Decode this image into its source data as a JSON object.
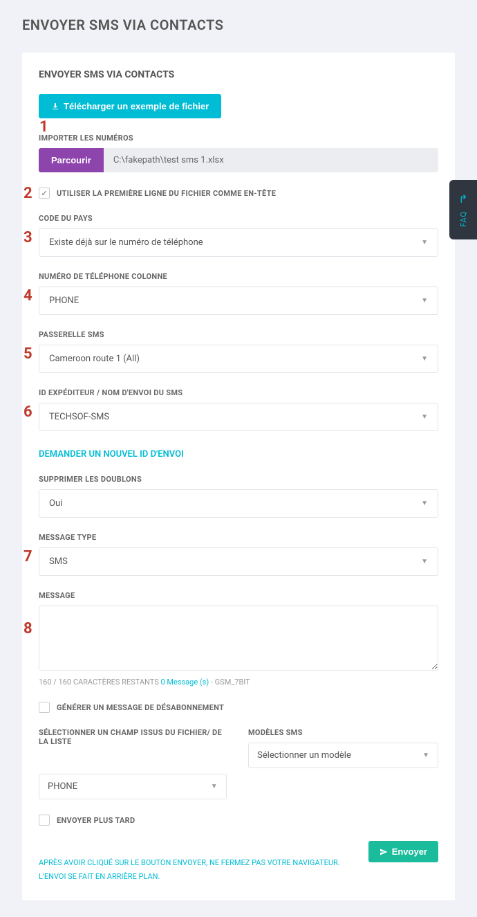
{
  "page": {
    "title": "ENVOYER SMS VIA CONTACTS"
  },
  "card": {
    "title": "ENVOYER SMS VIA CONTACTS"
  },
  "download": {
    "label": "Télécharger un exemple de fichier"
  },
  "importNums": {
    "label": "IMPORTER LES NUMÉROS",
    "browse": "Parcourir",
    "path": "C:\\fakepath\\test sms 1.xlsx"
  },
  "header_checkbox": {
    "label": "UTILISER LA PREMIÈRE LIGNE DU FICHIER COMME EN-TÊTE"
  },
  "country": {
    "label": "CODE DU PAYS",
    "value": "Existe déjà sur le numéro de téléphone"
  },
  "phoneCol": {
    "label": "NUMÉRO DE TÉLÉPHONE COLONNE",
    "value": "PHONE"
  },
  "gateway": {
    "label": "PASSERELLE SMS",
    "value": "Cameroon route 1 (All)"
  },
  "sender": {
    "label": "ID EXPÉDITEUR / NOM D'ENVOI DU SMS",
    "value": "TECHSOF-SMS"
  },
  "requestId": {
    "label": "DEMANDER UN NOUVEL ID D'ENVOI"
  },
  "dedupe": {
    "label": "SUPPRIMER LES DOUBLONS",
    "value": "Oui"
  },
  "msgType": {
    "label": "MESSAGE TYPE",
    "value": "SMS"
  },
  "message": {
    "label": "MESSAGE"
  },
  "counter": {
    "a": "160",
    "sep1": " / ",
    "b": "160 CARACTÈRES RESTANTS ",
    "c": "0 Message (s)",
    "sep2": " - ",
    "d": "GSM_7BIT"
  },
  "unsub": {
    "label": "GÉNÉRER UN MESSAGE DE DÉSABONNEMENT"
  },
  "fieldSel": {
    "label": "SÉLECTIONNER UN CHAMP ISSUS DU FICHIER/ DE LA LISTE",
    "value": "PHONE"
  },
  "template": {
    "label": "MODÈLES SMS",
    "value": "Sélectionner un modèle"
  },
  "later": {
    "label": "ENVOYER PLUS TARD"
  },
  "notice": {
    "text": "APRÈS AVOIR CLIQUÉ SUR LE BOUTON ENVOYER, NE FERMEZ PAS VOTRE NAVIGATEUR. L'ENVOI SE FAIT EN ARRIÈRE PLAN."
  },
  "send": {
    "label": "Envoyer"
  },
  "faq": {
    "label": "FAQ"
  },
  "steps": {
    "s1": "1",
    "s2": "2",
    "s3": "3",
    "s4": "4",
    "s5": "5",
    "s6": "6",
    "s7": "7",
    "s8": "8"
  }
}
